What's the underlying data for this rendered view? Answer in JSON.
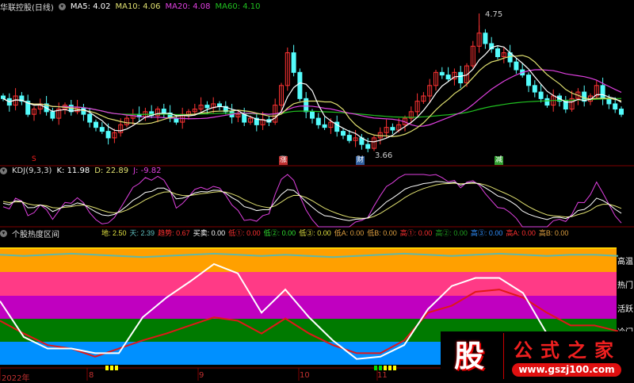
{
  "header": {
    "title": "华联控股(日线)",
    "ma5": "MA5: 4.02",
    "ma10": "MA10: 4.06",
    "ma20": "MA20: 4.08",
    "ma60": "MA60: 4.10"
  },
  "colors": {
    "up": "#ff3333",
    "down": "#54fcfc",
    "ma5": "#ffffff",
    "ma10": "#e0e070",
    "ma20": "#e040e0",
    "ma60": "#20c020"
  },
  "price_labels": {
    "high": "4.75",
    "low": "3.66"
  },
  "markers": [
    {
      "text": "S",
      "color": "#ff2020"
    },
    {
      "text": "涨",
      "color": "#c03030"
    },
    {
      "text": "财",
      "color": "#3060a0"
    },
    {
      "text": "减",
      "color": "#30a030"
    }
  ],
  "kdj": {
    "title": "KDJ(9,3,3)",
    "k": "K: 11.98",
    "d": "D: 22.89",
    "j": "J: -9.82"
  },
  "heat": {
    "title": "个股热度区间",
    "items": [
      {
        "t": "地: 2.50",
        "c": "#e0e040"
      },
      {
        "t": "天: 2.39",
        "c": "#60c0c0"
      },
      {
        "t": "趋势: 0.67",
        "c": "#ff3030"
      },
      {
        "t": "买卖: 0.00",
        "c": "#ffffff"
      },
      {
        "t": "低①: 0.00",
        "c": "#ff3030"
      },
      {
        "t": "低②: 0.00",
        "c": "#30e030"
      },
      {
        "t": "低③: 0.00",
        "c": "#e0e040"
      },
      {
        "t": "低A: 0.00",
        "c": "#e0a040"
      },
      {
        "t": "低B: 0.00",
        "c": "#e0a040"
      },
      {
        "t": "高①: 0.00",
        "c": "#ff3030"
      },
      {
        "t": "高②: 0.00",
        "c": "#20a020"
      },
      {
        "t": "高③: 0.00",
        "c": "#3090ff"
      },
      {
        "t": "高A: 0.00",
        "c": "#ff3030"
      },
      {
        "t": "高B: 0.00",
        "c": "#e0a040"
      }
    ],
    "zones": [
      "高温",
      "热门",
      "活跃",
      "冷门"
    ]
  },
  "axis": {
    "labels": [
      "2022年",
      "8",
      "9",
      "10",
      "11"
    ]
  },
  "watermark": {
    "icon": "股",
    "name": "公式之家",
    "url": "www.gszj100.com"
  },
  "chart_data": {
    "type": "candlestick",
    "closes": [
      4.1,
      4.05,
      4.12,
      4.08,
      3.98,
      4.02,
      4.06,
      4.0,
      3.95,
      4.02,
      4.05,
      4.0,
      4.03,
      3.98,
      3.92,
      3.88,
      3.85,
      3.8,
      3.84,
      3.9,
      3.95,
      3.98,
      3.96,
      4.0,
      3.97,
      4.02,
      3.99,
      3.95,
      3.92,
      3.98,
      4.0,
      4.02,
      4.05,
      4.03,
      4.06,
      4.04,
      4.0,
      3.96,
      3.98,
      3.92,
      3.95,
      3.9,
      3.94,
      3.92,
      4.05,
      4.2,
      4.45,
      4.3,
      4.1,
      4.0,
      3.95,
      3.9,
      3.88,
      3.92,
      3.85,
      3.82,
      3.78,
      3.8,
      3.75,
      3.72,
      3.8,
      3.84,
      3.88,
      3.86,
      3.9,
      3.95,
      4.0,
      4.08,
      4.12,
      4.2,
      4.3,
      4.28,
      4.25,
      4.3,
      4.22,
      4.35,
      4.5,
      4.6,
      4.52,
      4.48,
      4.42,
      4.45,
      4.38,
      4.32,
      4.28,
      4.2,
      4.15,
      4.1,
      4.05,
      4.12,
      4.08,
      4.02,
      4.1,
      4.15,
      4.08,
      4.12,
      4.2,
      4.1,
      4.06,
      4.02,
      3.98
    ],
    "ylim": [
      3.5,
      4.85
    ],
    "heat_white": [
      55,
      24,
      14,
      14,
      10,
      10,
      41,
      58,
      72,
      87,
      79,
      45,
      65,
      41,
      21,
      5,
      7,
      17,
      48,
      68,
      75,
      75,
      62,
      27,
      7,
      3,
      3
    ],
    "heat_red": [
      38,
      27,
      17,
      14,
      7,
      14,
      21,
      27,
      34,
      41,
      38,
      27,
      40,
      27,
      17,
      10,
      10,
      21,
      45,
      51,
      63,
      65,
      58,
      45,
      34,
      34,
      29
    ],
    "heat_teal": [
      95,
      94,
      95,
      96,
      95,
      94,
      93,
      94,
      95,
      96,
      95,
      94,
      95,
      94,
      93,
      94,
      95,
      96,
      95,
      94,
      95,
      96,
      95,
      94,
      95,
      95,
      94
    ],
    "heat_ylim": [
      0,
      100
    ]
  }
}
